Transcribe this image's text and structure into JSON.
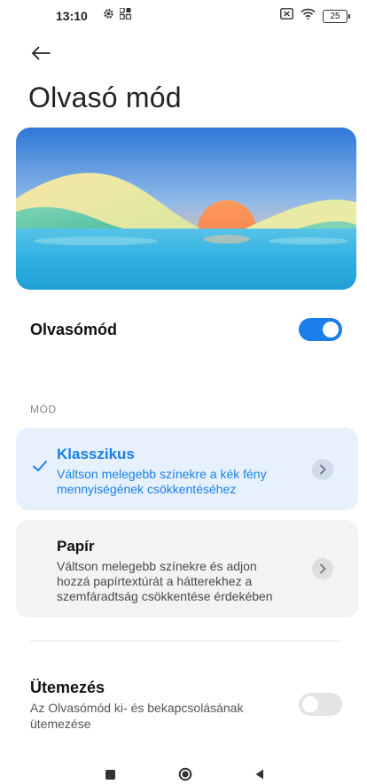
{
  "status_bar": {
    "time": "13:10",
    "battery": "25",
    "icons": [
      "gear-icon",
      "apps-grid-icon",
      "sim-icon",
      "wifi-icon",
      "battery-icon"
    ]
  },
  "header": {
    "back_icon": "arrow-left-icon",
    "title": "Olvasó mód"
  },
  "reading_mode_toggle": {
    "label": "Olvasómód",
    "state": "on",
    "accent": "#1a7fe8"
  },
  "modes_section": {
    "header": "MÓD",
    "options": [
      {
        "title": "Klasszikus",
        "description": "Váltson melegebb színekre a kék fény mennyiségének csökkentéséhez",
        "selected": true
      },
      {
        "title": "Papír",
        "description": "Váltson melegebb színekre és adjon hozzá papírtextúrát a hátterekhez a szemfáradtság csökkentése érdekében",
        "selected": false
      }
    ]
  },
  "schedule": {
    "title": "Ütemezés",
    "description": "Az Olvasómód ki- és bekapcsolásának ütemezése",
    "state": "off"
  },
  "nav_bar": {
    "buttons": [
      "recents-square-icon",
      "home-circle-icon",
      "back-triangle-icon"
    ]
  }
}
